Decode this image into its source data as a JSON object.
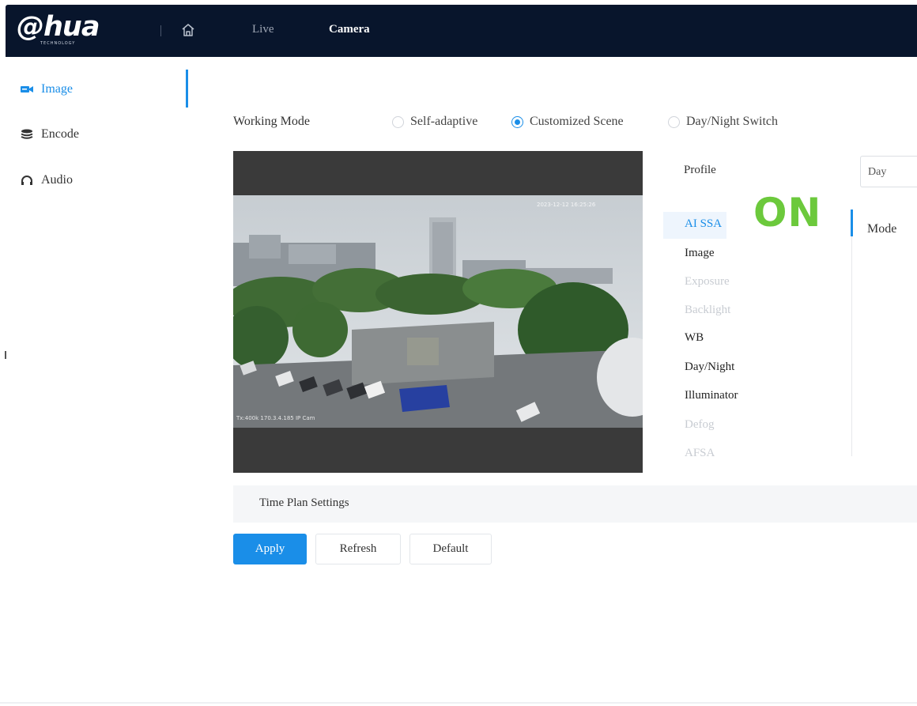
{
  "brand": {
    "logo_text": "@hua",
    "logo_sub": "TECHNOLOGY"
  },
  "header": {
    "nav": [
      {
        "label": "Live"
      },
      {
        "label": "Camera"
      }
    ]
  },
  "sidebar": {
    "items": [
      {
        "label": "Image",
        "icon": "camera-icon"
      },
      {
        "label": "Encode",
        "icon": "layers-icon"
      },
      {
        "label": "Audio",
        "icon": "headphones-icon"
      }
    ]
  },
  "working_mode": {
    "label": "Working Mode",
    "options": [
      "Self-adaptive",
      "Customized Scene",
      "Day/Night Switch"
    ],
    "selected": "Customized Scene"
  },
  "preview": {
    "osd_time": "2023-12-12 16:25:26",
    "osd_info": "Tx:400k 170.3.4.185 IP Cam"
  },
  "profile": {
    "label": "Profile",
    "value": "Day"
  },
  "menu": {
    "items": [
      "AI SSA",
      "Image",
      "Exposure",
      "Backlight",
      "WB",
      "Day/Night",
      "Illuminator",
      "Defog",
      "AFSA"
    ],
    "active": "AI SSA",
    "disabled": [
      "Exposure",
      "Backlight",
      "Defog",
      "AFSA"
    ]
  },
  "overlay_text": "ON",
  "mode_label": "Mode",
  "time_plan": {
    "label": "Time Plan Settings"
  },
  "buttons": {
    "apply": "Apply",
    "refresh": "Refresh",
    "default": "Default"
  },
  "colors": {
    "topbar": "#08152c",
    "accent": "#1a8ee8",
    "on_text": "#6cc93c"
  }
}
